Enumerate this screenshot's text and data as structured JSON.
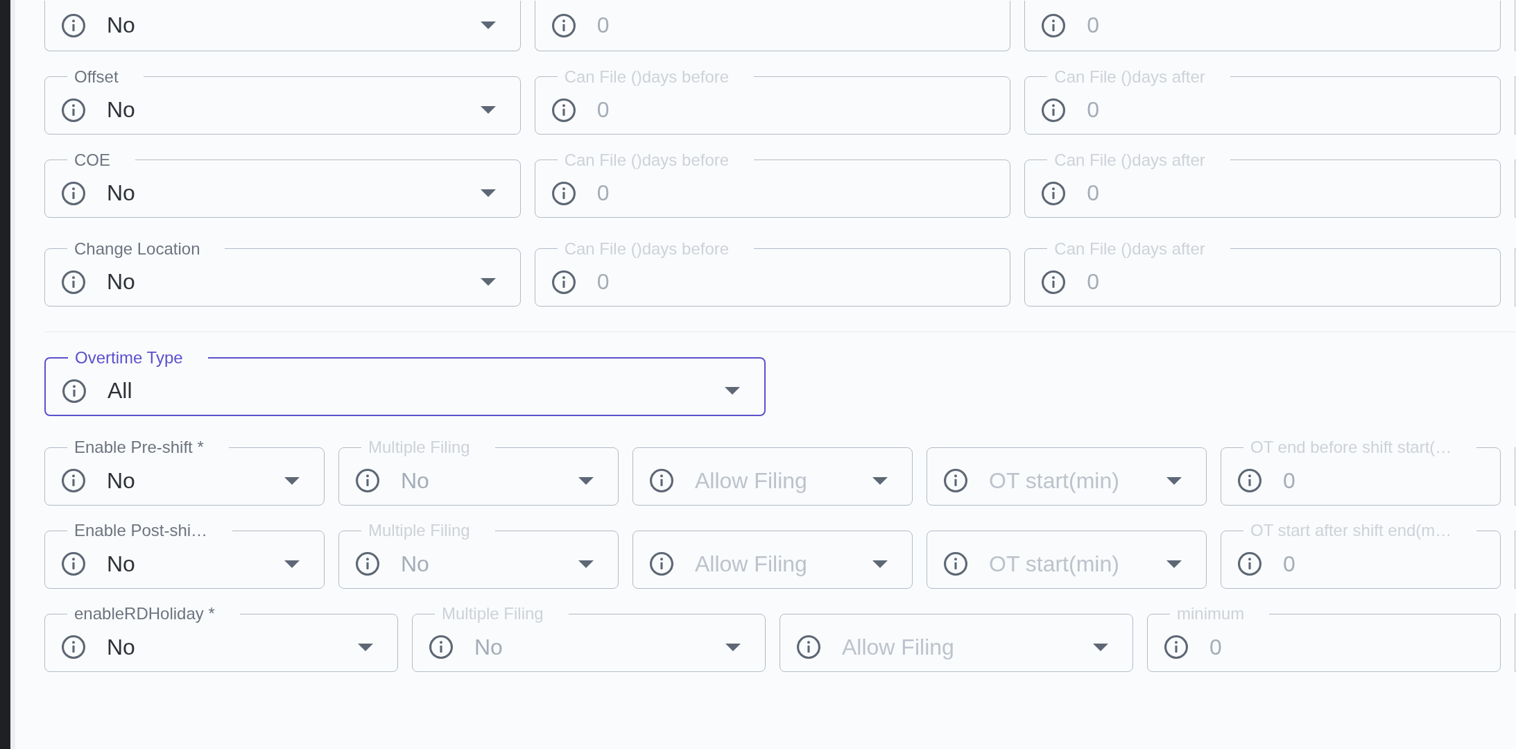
{
  "leave_rows": [
    {
      "fields": [
        {
          "kind": "select",
          "value": "No",
          "disabled": false
        },
        {
          "kind": "input",
          "value": "0",
          "disabled": true
        },
        {
          "kind": "input",
          "value": "0",
          "disabled": true
        }
      ]
    },
    {
      "fields": [
        {
          "kind": "select",
          "label": "Offset",
          "value": "No",
          "disabled": false
        },
        {
          "kind": "input",
          "label": "Can File ()days before",
          "value": "0",
          "disabled": true
        },
        {
          "kind": "input",
          "label": "Can File ()days after",
          "value": "0",
          "disabled": true
        }
      ]
    },
    {
      "fields": [
        {
          "kind": "select",
          "label": "COE",
          "value": "No",
          "disabled": false
        },
        {
          "kind": "input",
          "label": "Can File ()days before",
          "value": "0",
          "disabled": true
        },
        {
          "kind": "input",
          "label": "Can File ()days after",
          "value": "0",
          "disabled": true
        }
      ]
    },
    {
      "fields": [
        {
          "kind": "select",
          "label": "Change Location",
          "value": "No",
          "disabled": false
        },
        {
          "kind": "input",
          "label": "Can File ()days before",
          "value": "0",
          "disabled": true
        },
        {
          "kind": "input",
          "label": "Can File ()days after",
          "value": "0",
          "disabled": true
        }
      ]
    }
  ],
  "overtime_type": {
    "kind": "select",
    "label": "Overtime Type",
    "value": "All",
    "disabled": false,
    "focused": true
  },
  "overtime_rows": [
    {
      "fields": [
        {
          "kind": "select",
          "label": "Enable Pre-shift *",
          "value": "No",
          "disabled": false
        },
        {
          "kind": "select",
          "label": "Multiple Filing",
          "value": "No",
          "disabled": true
        },
        {
          "kind": "select",
          "placeholder": "Allow Filing",
          "disabled": true
        },
        {
          "kind": "select",
          "placeholder": "OT start(min)",
          "disabled": true
        },
        {
          "kind": "input",
          "label": "OT end before shift start(…",
          "value": "0",
          "disabled": true
        }
      ]
    },
    {
      "fields": [
        {
          "kind": "select",
          "label": "Enable Post-shi…",
          "value": "No",
          "disabled": false
        },
        {
          "kind": "select",
          "label": "Multiple Filing",
          "value": "No",
          "disabled": true
        },
        {
          "kind": "select",
          "placeholder": "Allow Filing",
          "disabled": true
        },
        {
          "kind": "select",
          "placeholder": "OT start(min)",
          "disabled": true
        },
        {
          "kind": "input",
          "label": "OT start after shift end(m…",
          "value": "0",
          "disabled": true
        }
      ]
    },
    {
      "fields": [
        {
          "kind": "select",
          "label": "enableRDHoliday *",
          "value": "No",
          "disabled": false
        },
        {
          "kind": "select",
          "label": "Multiple Filing",
          "value": "No",
          "disabled": true
        },
        {
          "kind": "select",
          "placeholder": "Allow Filing",
          "disabled": true
        },
        {
          "kind": "input",
          "label": "minimum",
          "value": "0",
          "disabled": true
        }
      ]
    }
  ]
}
